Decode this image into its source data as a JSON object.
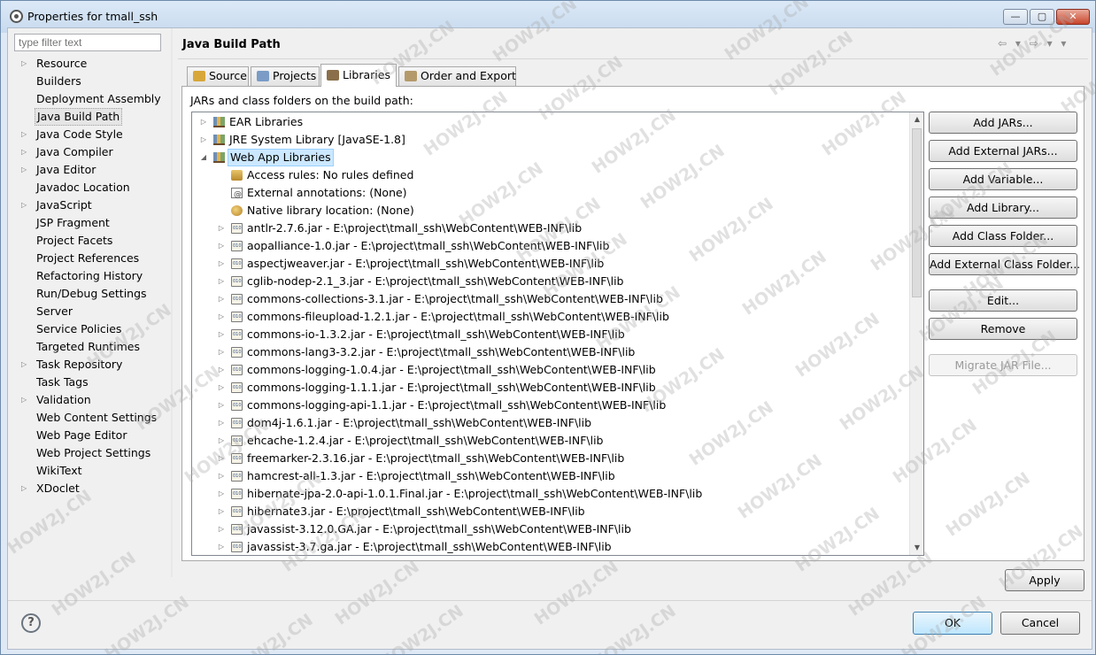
{
  "window": {
    "title": "Properties for tmall_ssh"
  },
  "window_controls": {
    "minimize": "—",
    "maximize": "▢",
    "close": "✕"
  },
  "filter": {
    "placeholder": "type filter text"
  },
  "nav": {
    "items": [
      {
        "label": "Resource",
        "expandable": true
      },
      {
        "label": "Builders",
        "expandable": false
      },
      {
        "label": "Deployment Assembly",
        "expandable": false
      },
      {
        "label": "Java Build Path",
        "expandable": false,
        "selected": true
      },
      {
        "label": "Java Code Style",
        "expandable": true
      },
      {
        "label": "Java Compiler",
        "expandable": true
      },
      {
        "label": "Java Editor",
        "expandable": true
      },
      {
        "label": "Javadoc Location",
        "expandable": false
      },
      {
        "label": "JavaScript",
        "expandable": true
      },
      {
        "label": "JSP Fragment",
        "expandable": false
      },
      {
        "label": "Project Facets",
        "expandable": false
      },
      {
        "label": "Project References",
        "expandable": false
      },
      {
        "label": "Refactoring History",
        "expandable": false
      },
      {
        "label": "Run/Debug Settings",
        "expandable": false
      },
      {
        "label": "Server",
        "expandable": false
      },
      {
        "label": "Service Policies",
        "expandable": false
      },
      {
        "label": "Targeted Runtimes",
        "expandable": false
      },
      {
        "label": "Task Repository",
        "expandable": true
      },
      {
        "label": "Task Tags",
        "expandable": false
      },
      {
        "label": "Validation",
        "expandable": true
      },
      {
        "label": "Web Content Settings",
        "expandable": false
      },
      {
        "label": "Web Page Editor",
        "expandable": false
      },
      {
        "label": "Web Project Settings",
        "expandable": false
      },
      {
        "label": "WikiText",
        "expandable": false
      },
      {
        "label": "XDoclet",
        "expandable": true
      }
    ]
  },
  "page": {
    "title": "Java Build Path",
    "nav_arrows": "⇦ ▾ ⇨ ▾ ▾"
  },
  "tabs": [
    {
      "label": "Source",
      "active": false
    },
    {
      "label": "Projects",
      "active": false
    },
    {
      "label": "Libraries",
      "active": true
    },
    {
      "label": "Order and Export",
      "active": false
    }
  ],
  "libraries": {
    "label": "JARs and class folders on the build path:",
    "tree": [
      {
        "text": "EAR Libraries",
        "icon": "library-icon",
        "level": 0,
        "toggle": "▷"
      },
      {
        "text": "JRE System Library [JavaSE-1.8]",
        "icon": "library-icon",
        "level": 0,
        "toggle": "▷"
      },
      {
        "text": "Web App Libraries",
        "icon": "library-icon",
        "level": 0,
        "toggle": "◢",
        "selected": true
      },
      {
        "text": "Access rules: No rules defined",
        "icon": "access-rules-icon",
        "level": 1,
        "toggle": ""
      },
      {
        "text": "External annotations: (None)",
        "icon": "annotations-icon",
        "level": 1,
        "toggle": ""
      },
      {
        "text": "Native library location: (None)",
        "icon": "native-library-icon",
        "level": 1,
        "toggle": ""
      },
      {
        "text": "antlr-2.7.6.jar - E:\\project\\tmall_ssh\\WebContent\\WEB-INF\\lib",
        "icon": "jar-icon",
        "level": 1,
        "toggle": "▷"
      },
      {
        "text": "aopalliance-1.0.jar - E:\\project\\tmall_ssh\\WebContent\\WEB-INF\\lib",
        "icon": "jar-icon",
        "level": 1,
        "toggle": "▷"
      },
      {
        "text": "aspectjweaver.jar - E:\\project\\tmall_ssh\\WebContent\\WEB-INF\\lib",
        "icon": "jar-icon",
        "level": 1,
        "toggle": "▷"
      },
      {
        "text": "cglib-nodep-2.1_3.jar - E:\\project\\tmall_ssh\\WebContent\\WEB-INF\\lib",
        "icon": "jar-icon",
        "level": 1,
        "toggle": "▷"
      },
      {
        "text": "commons-collections-3.1.jar - E:\\project\\tmall_ssh\\WebContent\\WEB-INF\\lib",
        "icon": "jar-icon",
        "level": 1,
        "toggle": "▷"
      },
      {
        "text": "commons-fileupload-1.2.1.jar - E:\\project\\tmall_ssh\\WebContent\\WEB-INF\\lib",
        "icon": "jar-icon",
        "level": 1,
        "toggle": "▷"
      },
      {
        "text": "commons-io-1.3.2.jar - E:\\project\\tmall_ssh\\WebContent\\WEB-INF\\lib",
        "icon": "jar-icon",
        "level": 1,
        "toggle": "▷"
      },
      {
        "text": "commons-lang3-3.2.jar - E:\\project\\tmall_ssh\\WebContent\\WEB-INF\\lib",
        "icon": "jar-icon",
        "level": 1,
        "toggle": "▷"
      },
      {
        "text": "commons-logging-1.0.4.jar - E:\\project\\tmall_ssh\\WebContent\\WEB-INF\\lib",
        "icon": "jar-icon",
        "level": 1,
        "toggle": "▷"
      },
      {
        "text": "commons-logging-1.1.1.jar - E:\\project\\tmall_ssh\\WebContent\\WEB-INF\\lib",
        "icon": "jar-icon",
        "level": 1,
        "toggle": "▷"
      },
      {
        "text": "commons-logging-api-1.1.jar - E:\\project\\tmall_ssh\\WebContent\\WEB-INF\\lib",
        "icon": "jar-icon",
        "level": 1,
        "toggle": "▷"
      },
      {
        "text": "dom4j-1.6.1.jar - E:\\project\\tmall_ssh\\WebContent\\WEB-INF\\lib",
        "icon": "jar-icon",
        "level": 1,
        "toggle": "▷"
      },
      {
        "text": "ehcache-1.2.4.jar - E:\\project\\tmall_ssh\\WebContent\\WEB-INF\\lib",
        "icon": "jar-icon",
        "level": 1,
        "toggle": "▷"
      },
      {
        "text": "freemarker-2.3.16.jar - E:\\project\\tmall_ssh\\WebContent\\WEB-INF\\lib",
        "icon": "jar-icon",
        "level": 1,
        "toggle": "▷"
      },
      {
        "text": "hamcrest-all-1.3.jar - E:\\project\\tmall_ssh\\WebContent\\WEB-INF\\lib",
        "icon": "jar-icon",
        "level": 1,
        "toggle": "▷"
      },
      {
        "text": "hibernate-jpa-2.0-api-1.0.1.Final.jar - E:\\project\\tmall_ssh\\WebContent\\WEB-INF\\lib",
        "icon": "jar-icon",
        "level": 1,
        "toggle": "▷"
      },
      {
        "text": "hibernate3.jar - E:\\project\\tmall_ssh\\WebContent\\WEB-INF\\lib",
        "icon": "jar-icon",
        "level": 1,
        "toggle": "▷"
      },
      {
        "text": "javassist-3.12.0.GA.jar - E:\\project\\tmall_ssh\\WebContent\\WEB-INF\\lib",
        "icon": "jar-icon",
        "level": 1,
        "toggle": "▷"
      },
      {
        "text": "javassist-3.7.ga.jar - E:\\project\\tmall_ssh\\WebContent\\WEB-INF\\lib",
        "icon": "jar-icon",
        "level": 1,
        "toggle": "▷"
      }
    ],
    "buttons": [
      {
        "label": "Add JARs...",
        "name": "add-jars-button",
        "enabled": true
      },
      {
        "label": "Add External JARs...",
        "name": "add-external-jars-button",
        "enabled": true
      },
      {
        "label": "Add Variable...",
        "name": "add-variable-button",
        "enabled": true
      },
      {
        "label": "Add Library...",
        "name": "add-library-button",
        "enabled": true
      },
      {
        "label": "Add Class Folder...",
        "name": "add-class-folder-button",
        "enabled": true
      },
      {
        "label": "Add External Class Folder...",
        "name": "add-external-class-folder-button",
        "enabled": true
      },
      {
        "label": "Edit...",
        "name": "edit-button",
        "enabled": true
      },
      {
        "label": "Remove",
        "name": "remove-button",
        "enabled": true
      },
      {
        "label": "Migrate JAR File...",
        "name": "migrate-jar-file-button",
        "enabled": false
      }
    ]
  },
  "footer": {
    "apply": "Apply",
    "ok": "OK",
    "cancel": "Cancel",
    "help": "?"
  },
  "watermark": "HOW2J.CN",
  "colors": {
    "selection": "#cce8ff",
    "ok_button": "#bee6fd",
    "close_button": "#c8452c"
  }
}
